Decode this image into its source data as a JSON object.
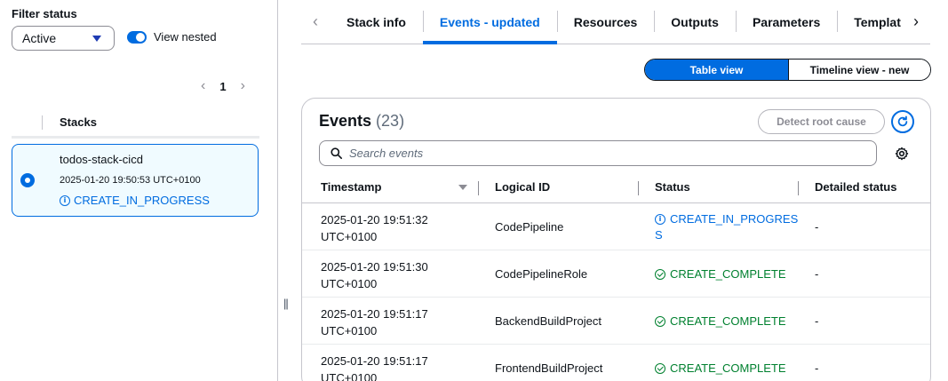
{
  "left_panel": {
    "filter_label": "Filter status",
    "filter_value": "Active",
    "view_nested_label": "View nested",
    "view_nested_on": true,
    "pagination": {
      "current_page": "1"
    },
    "stacks_header": "Stacks",
    "stacks": [
      {
        "name": "todos-stack-cicd",
        "timestamp": "2025-01-20 19:50:53 UTC+0100",
        "status": "CREATE_IN_PROGRESS",
        "selected": true
      }
    ]
  },
  "tabs": [
    {
      "label": "Stack info",
      "active": false
    },
    {
      "label": "Events - updated",
      "active": true
    },
    {
      "label": "Resources",
      "active": false
    },
    {
      "label": "Outputs",
      "active": false
    },
    {
      "label": "Parameters",
      "active": false
    },
    {
      "label": "Templat",
      "active": false
    }
  ],
  "view_toggle": {
    "table_label": "Table view",
    "timeline_label": "Timeline view - new",
    "selected": "table"
  },
  "events": {
    "title": "Events",
    "count": "(23)",
    "detect_root_cause_label": "Detect root cause",
    "search_placeholder": "Search events",
    "columns": {
      "timestamp": "Timestamp",
      "logical_id": "Logical ID",
      "status": "Status",
      "detailed_status": "Detailed status"
    },
    "rows": [
      {
        "timestamp_line1": "2025-01-20 19:51:32",
        "timestamp_line2": "UTC+0100",
        "logical_id": "CodePipeline",
        "status_line1": "CREATE_IN_PROGRES",
        "status_line2": "S",
        "detailed": "-"
      },
      {
        "timestamp_line1": "2025-01-20 19:51:30",
        "timestamp_line2": "UTC+0100",
        "logical_id": "CodePipelineRole",
        "status": "CREATE_COMPLETE",
        "detailed": "-"
      },
      {
        "timestamp_line1": "2025-01-20 19:51:17",
        "timestamp_line2": "UTC+0100",
        "logical_id": "BackendBuildProject",
        "status": "CREATE_COMPLETE",
        "detailed": "-"
      },
      {
        "timestamp_line1": "2025-01-20 19:51:17",
        "timestamp_line2": "UTC+0100",
        "logical_id": "FrontendBuildProject",
        "status": "CREATE_COMPLETE",
        "detailed": "-"
      }
    ]
  },
  "colors": {
    "accent": "#006ce0",
    "success": "#00802f",
    "text": "#0f141a",
    "border": "#c6c6cd"
  }
}
